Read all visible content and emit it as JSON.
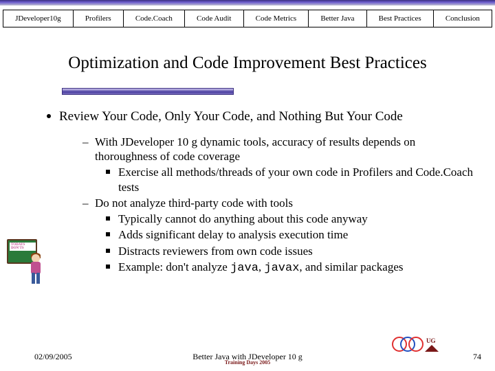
{
  "tabs": {
    "t0": "JDeveloper10g",
    "t1": "Profilers",
    "t2": "Code.Coach",
    "t3": "Code Audit",
    "t4": "Code Metrics",
    "t5": "Better Java",
    "t6": "Best Practices",
    "t7": "Conclusion"
  },
  "title": "Optimization and Code Improvement Best Practices",
  "bullets": {
    "main": "Review Your Code, Only Your Code, and Nothing But Your Code",
    "d1": "With JDeveloper 10 g dynamic tools, accuracy of results depends on thoroughness of code coverage",
    "sq1": "Exercise all methods/threads of your own code in Profilers and Code.Coach tests",
    "d2": "Do not analyze third-party code with tools",
    "sq2": "Typically cannot do anything about this code anyway",
    "sq3": "Adds significant delay to analysis execution time",
    "sq4": "Distracts reviewers from own code issues",
    "sq5_prefix": "Example: don't analyze ",
    "sq5_code1": "java",
    "sq5_mid": ", ",
    "sq5_code2": "javax",
    "sq5_suffix": ", and similar packages"
  },
  "clip": {
    "board": "TODAYS DON'TS"
  },
  "footer": {
    "date": "02/09/2005",
    "title": "Better Java with JDeveloper 10 g",
    "page": "74",
    "logo": "UG",
    "sub": "Training Days 2005"
  }
}
